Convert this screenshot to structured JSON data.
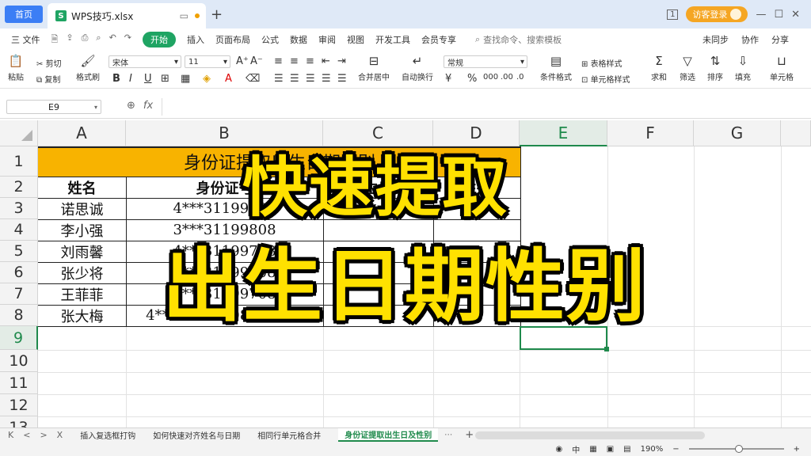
{
  "titlebar": {
    "home_tab": "首页",
    "doc_tab": "WPS技巧.xlsx",
    "new_tab": "+",
    "login": "访客登录",
    "window_count": "1"
  },
  "menu": {
    "file": "三 文件",
    "items": [
      "开始",
      "插入",
      "页面布局",
      "公式",
      "数据",
      "审阅",
      "视图",
      "开发工具",
      "会员专享"
    ],
    "search": "查找命令、搜索模板",
    "right": [
      "未同步",
      "协作",
      "分享"
    ]
  },
  "ribbon": {
    "paste": "粘贴",
    "cut": "剪切",
    "copy": "复制",
    "format_painter": "格式刷",
    "font_name": "宋体",
    "font_size": "11",
    "merge_center": "合并居中",
    "wrap": "自动换行",
    "number_format": "常规",
    "conditional": "条件格式",
    "table_style": "表格样式",
    "cell_style": "单元格样式",
    "sum": "求和",
    "filter": "筛选",
    "sort": "排序",
    "fill": "填充",
    "cells": "单元格",
    "bold": "B",
    "italic": "I",
    "underline": "U"
  },
  "formula": {
    "name_box": "E9",
    "value": ""
  },
  "grid": {
    "columns": [
      "A",
      "B",
      "C",
      "D",
      "E",
      "F",
      "G"
    ],
    "rows": [
      "1",
      "2",
      "3",
      "4",
      "5",
      "6",
      "7",
      "8",
      "9",
      "10",
      "11",
      "12",
      "13"
    ],
    "selected_col": "E",
    "selected_row": "9",
    "title": "身份证提取出生日期性别",
    "headers": [
      "姓名",
      "身份证号",
      "出生日期",
      "性别"
    ],
    "data": [
      [
        "诺思诚",
        "4***31199608"
      ],
      [
        "李小强",
        "3***31199808"
      ],
      [
        "刘雨馨",
        "4***31199708"
      ],
      [
        "张少将",
        "1***31199808"
      ],
      [
        "王菲菲",
        "5***31199708"
      ],
      [
        "张大梅",
        "4***31198808303621"
      ]
    ]
  },
  "overlay": {
    "line1": "快速提取",
    "line2": "出生日期性别"
  },
  "sheets": {
    "nav": [
      "K",
      "<",
      ">",
      "X"
    ],
    "tabs": [
      "插入复选框打钩",
      "如何快速对齐姓名与日期",
      "相同行单元格合并",
      "身份证提取出生日及性别"
    ],
    "active": 3,
    "add": "+"
  },
  "status": {
    "zoom": "190%"
  }
}
